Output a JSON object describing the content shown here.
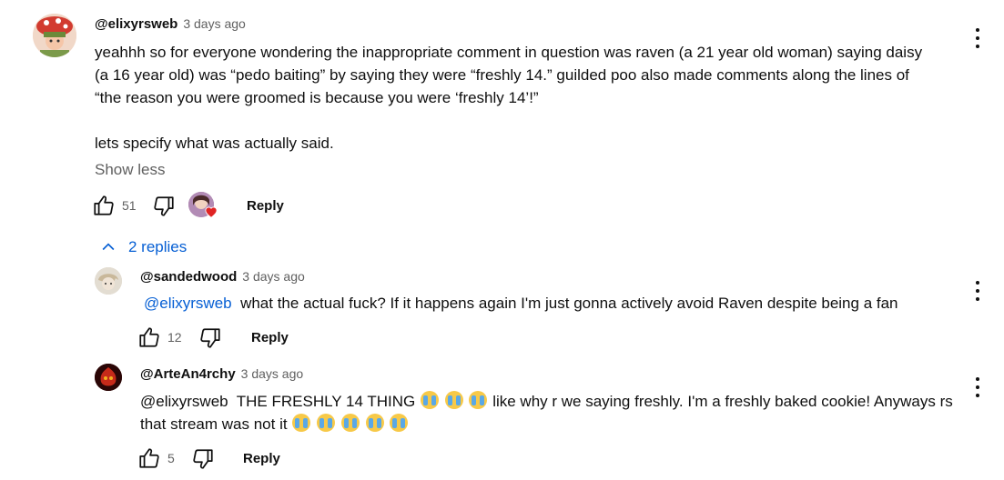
{
  "comment": {
    "author": "@elixyrsweb",
    "time": "3 days ago",
    "lines": [
      "yeahhh so for everyone wondering the inappropriate comment in question was raven (a 21 year old woman) saying daisy",
      "(a 16 year old) was “pedo baiting” by saying they were “freshly 14.” guilded poo also made comments along the lines of",
      "“the reason you were groomed is because you were ‘freshly 14’!”",
      "lets specify what was actually said."
    ],
    "show_less": "Show less",
    "likes": "51",
    "reply_label": "Reply"
  },
  "replies_toggle": "2 replies",
  "replies": [
    {
      "author": "@sandedwood",
      "time": "3 days ago",
      "mention": "@elixyrsweb",
      "text": "what the actual fuck? If it happens again I'm just gonna actively avoid Raven despite being a fan",
      "likes": "12",
      "reply_label": "Reply"
    },
    {
      "author": "@ArteAn4rchy",
      "time": "3 days ago",
      "mention": "@elixyrsweb",
      "text_a": "THE FRESHLY 14 THING",
      "text_b": "like why r we saying freshly. I'm a freshly baked cookie! Anyways rs",
      "text_c": "that stream was not it",
      "likes": "5",
      "reply_label": "Reply"
    }
  ],
  "emoji_name": "loudly-crying-face",
  "colors": {
    "link": "#065fd4",
    "secondary": "#606060",
    "heart": "#e02424"
  }
}
